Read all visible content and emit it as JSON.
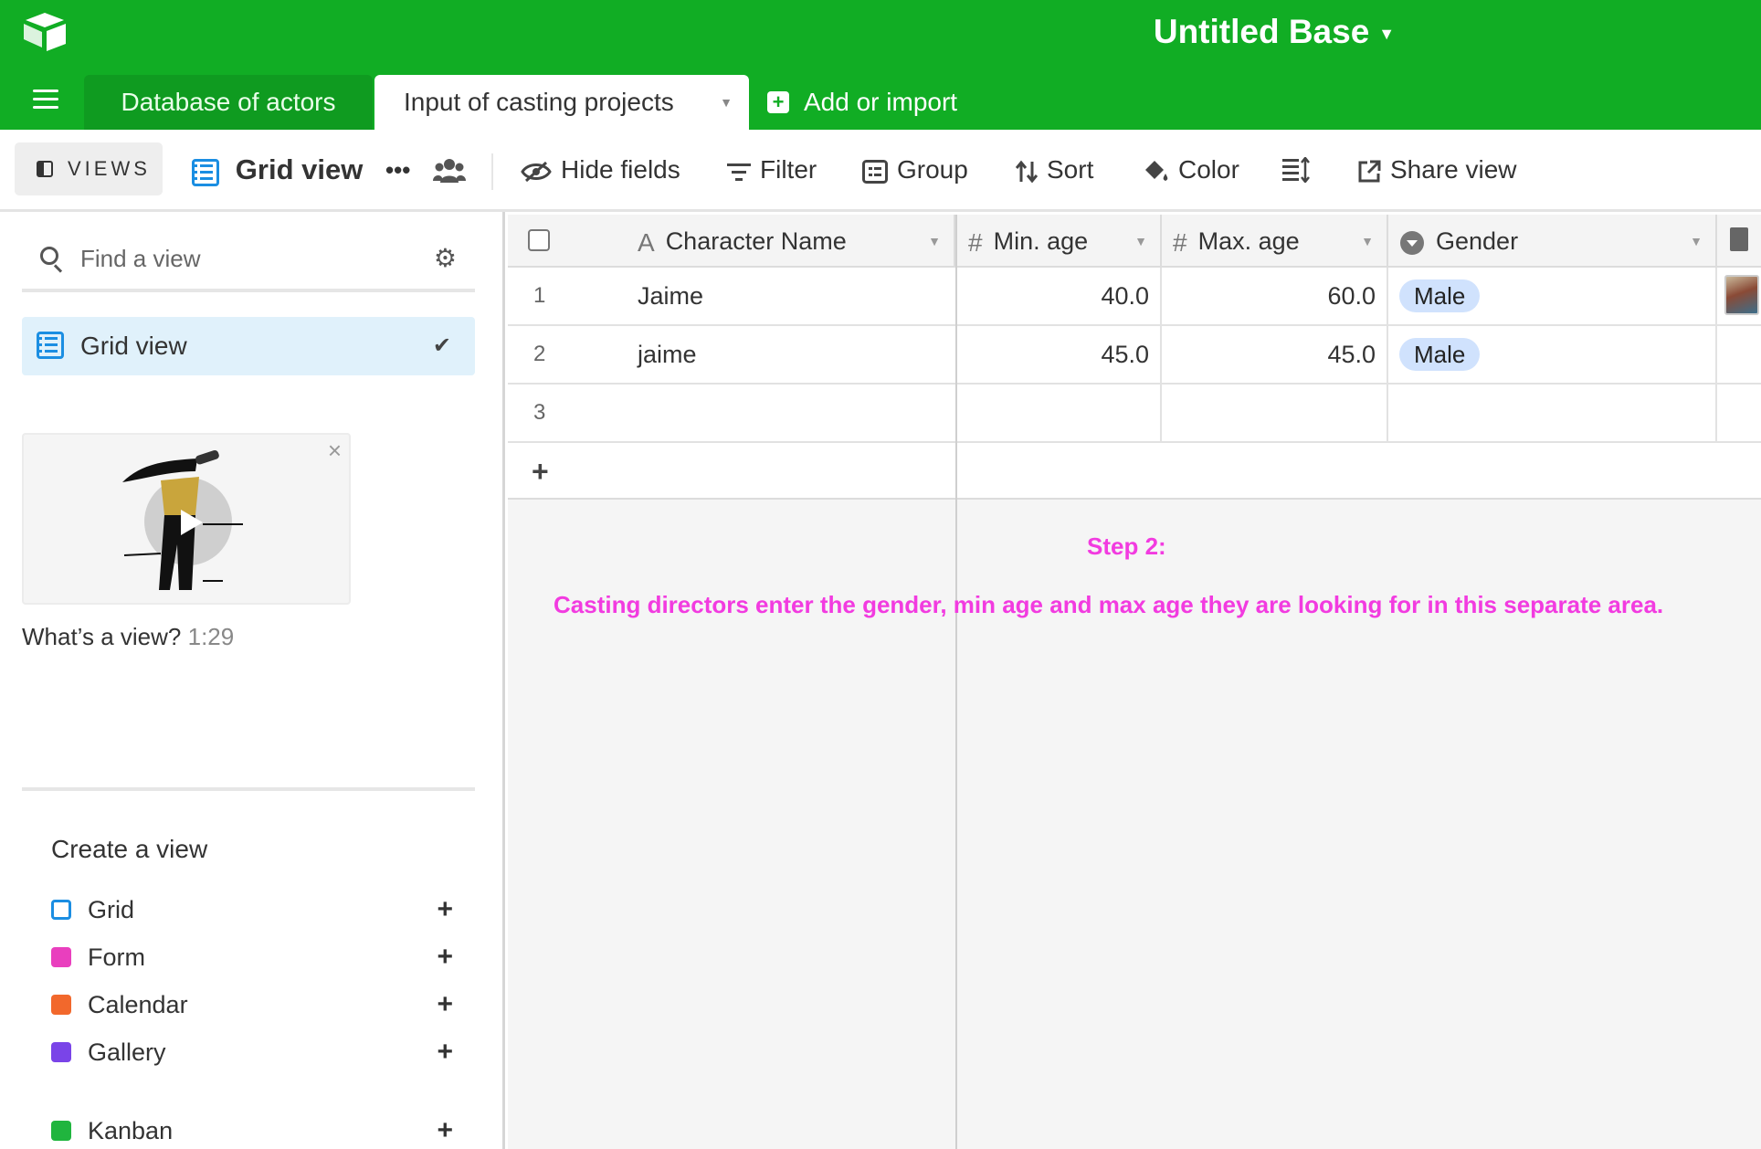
{
  "header": {
    "base_title": "Untitled Base",
    "tabs": [
      {
        "label": "Database of actors",
        "active": false
      },
      {
        "label": "Input of casting projects",
        "active": true
      }
    ],
    "add_import_label": "Add or import",
    "accent_color": "#11ad24"
  },
  "toolbar": {
    "views_label": "VIEWS",
    "current_view": "Grid view",
    "more_icon": "ellipsis-icon",
    "collab_icon": "people-icon",
    "hide_fields": "Hide fields",
    "filter": "Filter",
    "group": "Group",
    "sort": "Sort",
    "color": "Color",
    "share_view": "Share view"
  },
  "sidebar": {
    "find_placeholder": "Find a view",
    "active_view": "Grid view",
    "video_caption": "What’s a view?",
    "video_duration": "1:29",
    "create_title": "Create a view",
    "create_items": [
      {
        "label": "Grid",
        "color": "#1b8ee2"
      },
      {
        "label": "Form",
        "color": "#e93fbe"
      },
      {
        "label": "Calendar",
        "color": "#f2682c"
      },
      {
        "label": "Gallery",
        "color": "#7a44e8"
      },
      {
        "label": "Kanban",
        "color": "#20b53e"
      }
    ]
  },
  "grid": {
    "columns": [
      {
        "label": "Character Name",
        "type_icon": "A"
      },
      {
        "label": "Min. age",
        "type_icon": "#"
      },
      {
        "label": "Max. age",
        "type_icon": "#"
      },
      {
        "label": "Gender",
        "type_icon": "single-select-icon"
      }
    ],
    "rows": [
      {
        "num": "1",
        "name": "Jaime",
        "min_age": "40.0",
        "max_age": "60.0",
        "gender": "Male"
      },
      {
        "num": "2",
        "name": "jaime",
        "min_age": "45.0",
        "max_age": "45.0",
        "gender": "Male"
      },
      {
        "num": "3",
        "name": "",
        "min_age": "",
        "max_age": "",
        "gender": ""
      }
    ],
    "add_row_symbol": "+"
  },
  "annotation": {
    "step": "Step 2:",
    "text": "Casting directors enter the gender, min age and max age they are looking for in this separate area.",
    "color": "#f23be0"
  }
}
